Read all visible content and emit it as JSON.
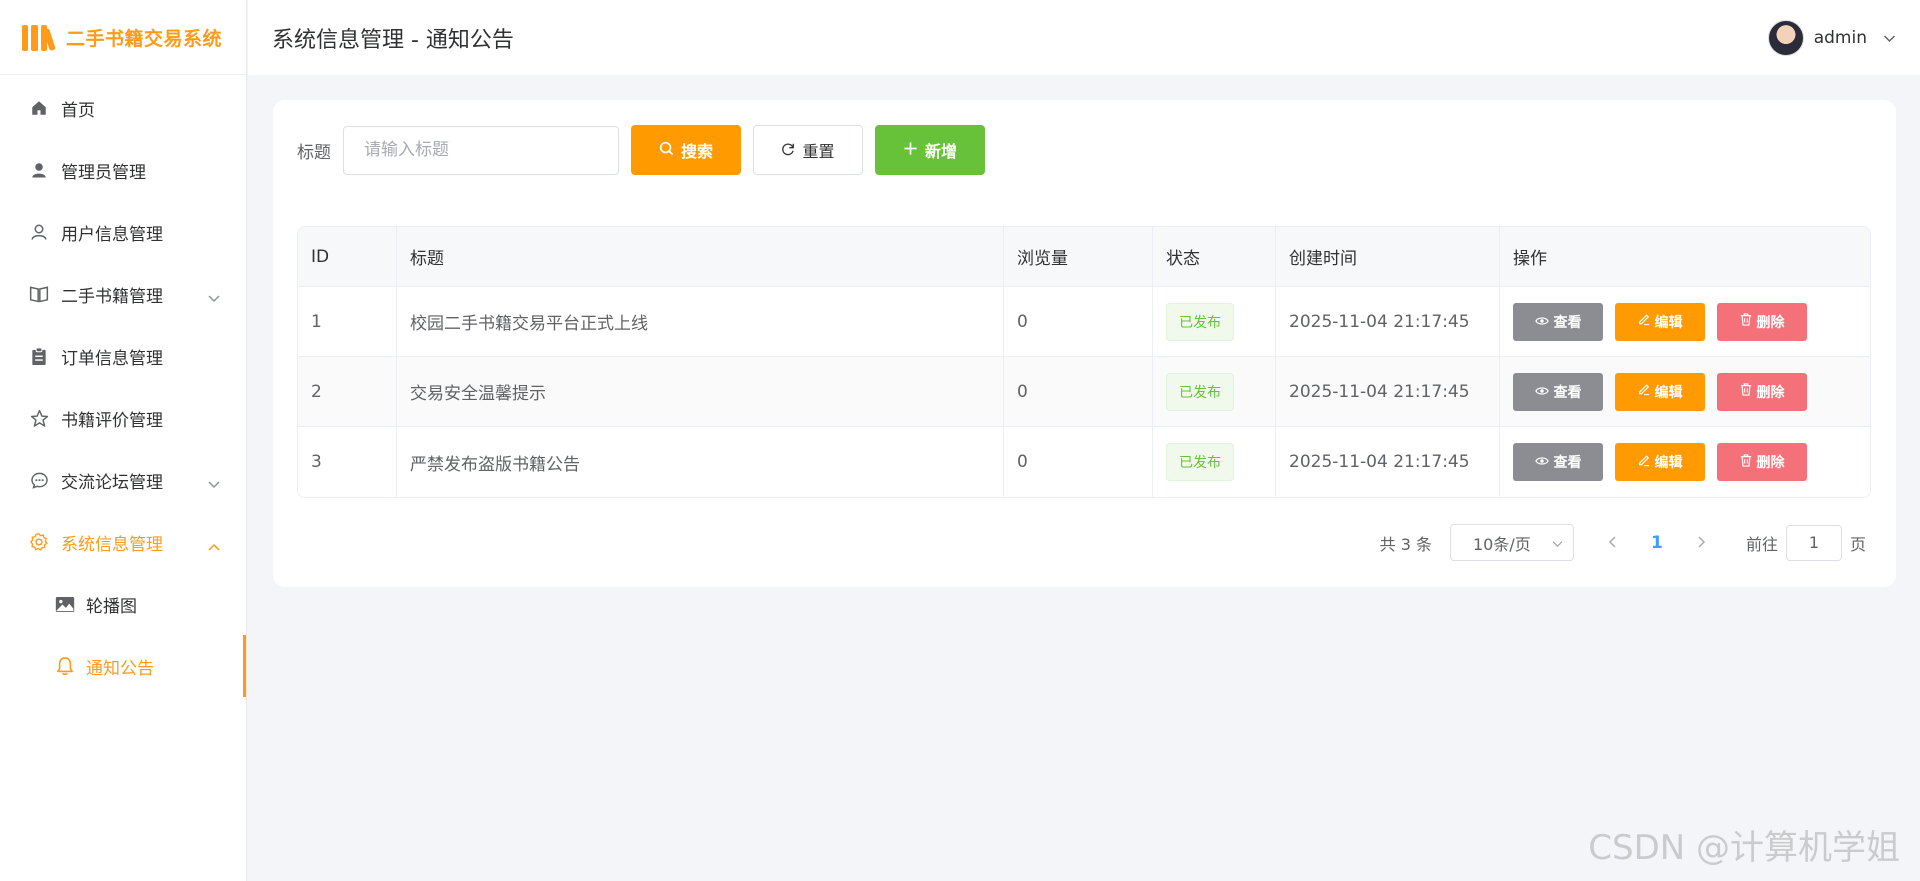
{
  "app": {
    "name": "二手书籍交易系统",
    "brand_color": "#ff9a1a"
  },
  "header": {
    "page_title": "系统信息管理 - 通知公告",
    "username": "admin"
  },
  "sidebar": {
    "items": [
      {
        "label": "首页",
        "icon": "home-icon"
      },
      {
        "label": "管理员管理",
        "icon": "user-filled-icon"
      },
      {
        "label": "用户信息管理",
        "icon": "user-icon"
      },
      {
        "label": "二手书籍管理",
        "icon": "book-icon",
        "expandable": true
      },
      {
        "label": "订单信息管理",
        "icon": "clipboard-icon"
      },
      {
        "label": "书籍评价管理",
        "icon": "star-icon"
      },
      {
        "label": "交流论坛管理",
        "icon": "chat-icon",
        "expandable": true
      },
      {
        "label": "系统信息管理",
        "icon": "gear-icon",
        "expandable": true,
        "expanded": true
      }
    ],
    "subitems": [
      {
        "label": "轮播图",
        "icon": "image-icon"
      },
      {
        "label": "通知公告",
        "icon": "bell-icon",
        "active": true
      }
    ]
  },
  "toolbar": {
    "title_label": "标题",
    "search_placeholder": "请输入标题",
    "search_value": "",
    "search_label": "搜索",
    "reset_label": "重置",
    "add_label": "新增"
  },
  "table": {
    "columns": [
      "ID",
      "标题",
      "浏览量",
      "状态",
      "创建时间",
      "操作"
    ],
    "rows": [
      {
        "id": "1",
        "title": "校园二手书籍交易平台正式上线",
        "views": "0",
        "status": "已发布",
        "created": "2025-11-04 21:17:45"
      },
      {
        "id": "2",
        "title": "交易安全温馨提示",
        "views": "0",
        "status": "已发布",
        "created": "2025-11-04 21:17:45"
      },
      {
        "id": "3",
        "title": "严禁发布盗版书籍公告",
        "views": "0",
        "status": "已发布",
        "created": "2025-11-04 21:17:45"
      }
    ],
    "actions": {
      "view": "查看",
      "edit": "编辑",
      "delete": "删除"
    }
  },
  "pagination": {
    "total_text": "共 3 条",
    "page_size": "10条/页",
    "current_page": "1",
    "goto_label": "前往",
    "goto_value": "1",
    "page_suffix": "页"
  },
  "watermark": "CSDN @计算机学姐"
}
